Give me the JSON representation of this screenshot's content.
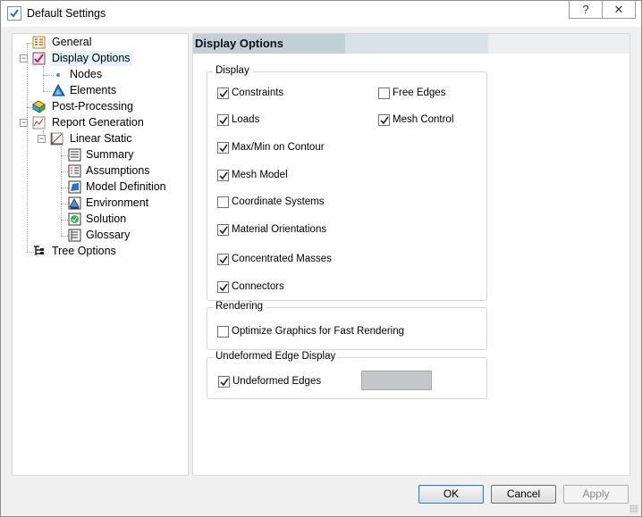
{
  "window": {
    "title": "Default Settings",
    "help_label": "?",
    "close_label": "✕"
  },
  "tree": {
    "items": [
      {
        "label": "General",
        "icon": "general-settings-icon"
      },
      {
        "label": "Display Options",
        "icon": "display-options-icon",
        "selected": true
      },
      {
        "label": "Nodes",
        "icon": "node-dot-icon"
      },
      {
        "label": "Elements",
        "icon": "elements-icon"
      },
      {
        "label": "Post-Processing",
        "icon": "post-processing-icon"
      },
      {
        "label": "Report Generation",
        "icon": "report-generation-icon"
      },
      {
        "label": "Linear Static",
        "icon": "linear-static-icon"
      },
      {
        "label": "Summary",
        "icon": "summary-icon"
      },
      {
        "label": "Assumptions",
        "icon": "assumptions-icon"
      },
      {
        "label": "Model Definition",
        "icon": "model-definition-icon"
      },
      {
        "label": "Environment",
        "icon": "environment-icon"
      },
      {
        "label": "Solution",
        "icon": "solution-icon"
      },
      {
        "label": "Glossary",
        "icon": "glossary-icon"
      },
      {
        "label": "Tree Options",
        "icon": "tree-options-icon"
      }
    ]
  },
  "panel": {
    "header": "Display Options",
    "display_group": {
      "title": "Display",
      "options": [
        {
          "label": "Constraints",
          "checked": true
        },
        {
          "label": "Free Edges",
          "checked": false
        },
        {
          "label": "Loads",
          "checked": true
        },
        {
          "label": "Mesh Control",
          "checked": true
        },
        {
          "label": "Max/Min on Contour",
          "checked": true
        },
        {
          "label": "Mesh Model",
          "checked": true
        },
        {
          "label": "Coordinate Systems",
          "checked": false
        },
        {
          "label": "Material Orientations",
          "checked": true
        },
        {
          "label": "Concentrated Masses",
          "checked": true
        },
        {
          "label": "Connectors",
          "checked": true
        }
      ]
    },
    "rendering_group": {
      "title": "Rendering",
      "options": [
        {
          "label": "Optimize Graphics for Fast Rendering",
          "checked": false
        }
      ]
    },
    "edge_group": {
      "title": "Undeformed Edge Display",
      "options": [
        {
          "label": "Undeformed Edges",
          "checked": true
        }
      ],
      "swatch_color": "#c3c7ca"
    }
  },
  "buttons": {
    "ok": "OK",
    "cancel": "Cancel",
    "apply": "Apply"
  },
  "colors": {
    "selection": "#e5f3fb",
    "header_band": "#c4d0d8",
    "default_button_border": "#3c7fb1"
  }
}
